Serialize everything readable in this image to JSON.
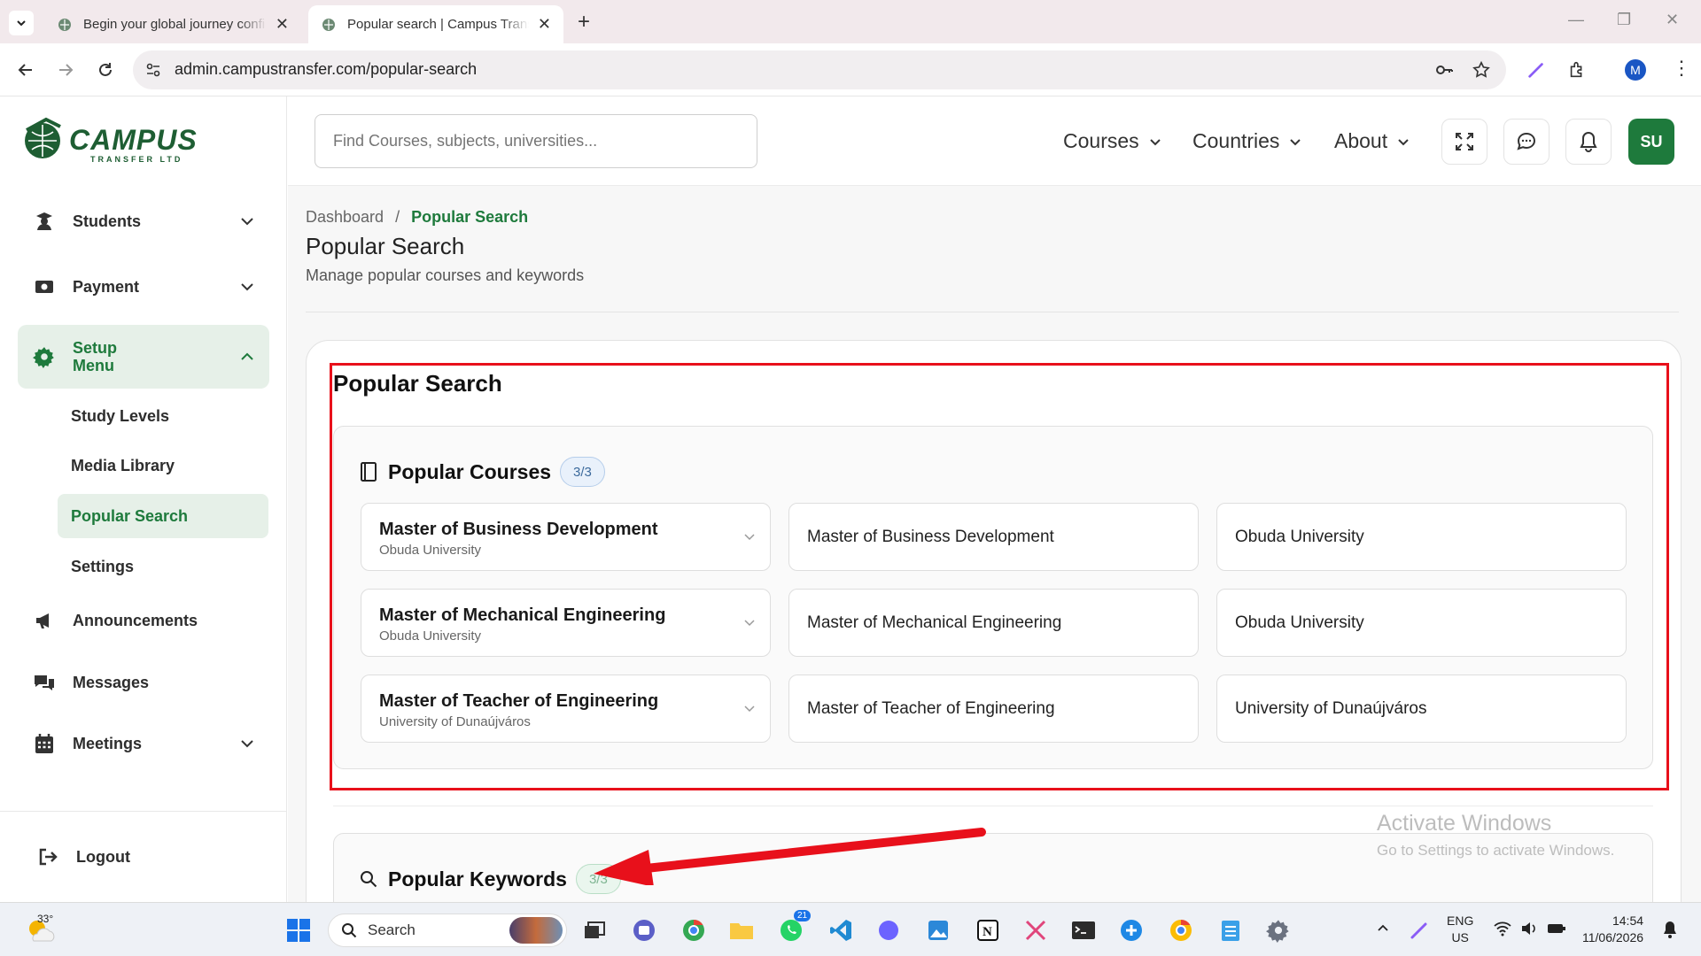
{
  "browser": {
    "tabs": [
      {
        "title": "Begin your global journey confi"
      },
      {
        "title": "Popular search | Campus Transf"
      }
    ],
    "url": "admin.campustransfer.com/popular-search",
    "profile_initial": "M"
  },
  "sidebar": {
    "logo_text": "CAMPUS",
    "logo_sub": "TRANSFER LTD",
    "items": [
      {
        "label": "Students"
      },
      {
        "label": "Payment"
      },
      {
        "label": "Setup Menu"
      },
      {
        "label": "Announcements"
      },
      {
        "label": "Messages"
      },
      {
        "label": "Meetings"
      }
    ],
    "setup_sub": [
      {
        "label": "Study Levels"
      },
      {
        "label": "Media Library"
      },
      {
        "label": "Popular Search"
      },
      {
        "label": "Settings"
      }
    ],
    "logout": "Logout"
  },
  "header": {
    "search_placeholder": "Find Courses, subjects, universities...",
    "nav": [
      {
        "label": "Courses"
      },
      {
        "label": "Countries"
      },
      {
        "label": "About"
      }
    ],
    "avatar": "SU"
  },
  "page": {
    "breadcrumb": {
      "root": "Dashboard",
      "sep": "/",
      "current": "Popular Search"
    },
    "title": "Popular Search",
    "subtitle": "Manage popular courses and keywords",
    "card_title": "Popular Search",
    "courses": {
      "heading": "Popular Courses",
      "badge": "3/3",
      "rows": [
        {
          "name": "Master of Business Development",
          "university": "Obuda University",
          "name_value": "Master of Business Development",
          "university_value": "Obuda University"
        },
        {
          "name": "Master of Mechanical Engineering",
          "university": "Obuda University",
          "name_value": "Master of Mechanical Engineering",
          "university_value": "Obuda University"
        },
        {
          "name": "Master of Teacher of Engineering",
          "university": "University of Dunaújváros",
          "name_value": "Master of Teacher of Engineering",
          "university_value": "University of Dunaújváros"
        }
      ]
    },
    "keywords": {
      "heading": "Popular Keywords",
      "badge": "3/3"
    }
  },
  "watermark": {
    "line1": "Activate Windows",
    "line2": "Go to Settings to activate Windows."
  },
  "taskbar": {
    "weather_temp": "33°",
    "search_label": "Search",
    "lang1": "ENG",
    "lang2": "US",
    "time": "14:54",
    "date": "11/06/2026",
    "whatsapp_badge": "21"
  },
  "colors": {
    "brand_green": "#1e7a3c",
    "highlight_red": "#e8101b"
  }
}
